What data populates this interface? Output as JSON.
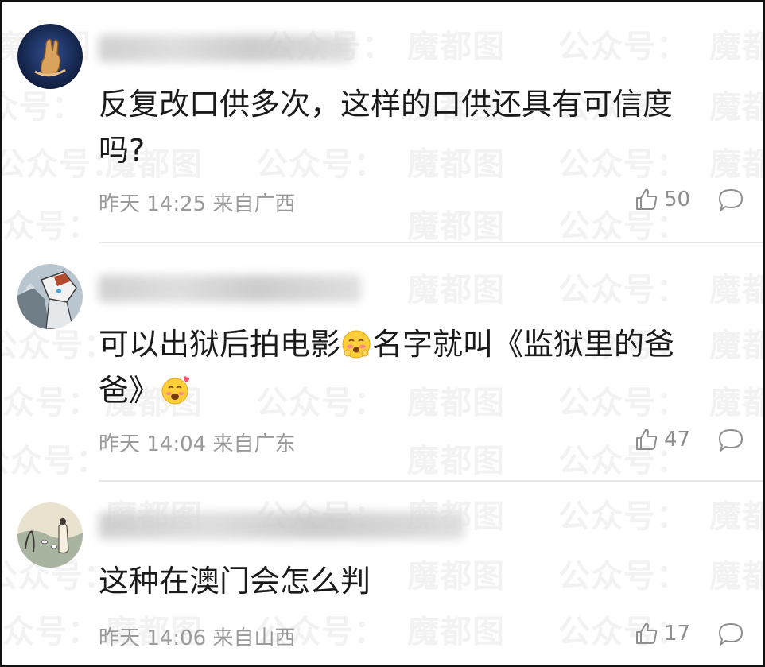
{
  "watermark": {
    "text_a": "魔都图",
    "text_b": "公众号："
  },
  "comments": [
    {
      "text": "反复改口供多次，这样的口供还具有可信度吗?",
      "time": "昨天 14:25 来自广西",
      "likes": "50",
      "avatar_icon": "hand-avatar-icon"
    },
    {
      "text_1": "可以出狱后拍电影",
      "text_2": "名字就叫《监狱里的爸爸》",
      "time": "昨天 14:04 来自广东",
      "likes": "47",
      "avatar_icon": "robot-avatar-icon"
    },
    {
      "text": "这种在澳门会怎么判",
      "time": "昨天 14:06 来自山西",
      "likes": "17",
      "avatar_icon": "painting-avatar-icon"
    }
  ],
  "colors": {
    "text": "#1a1a1a",
    "meta": "#9a9a9a",
    "divider": "#e6e6e6"
  }
}
